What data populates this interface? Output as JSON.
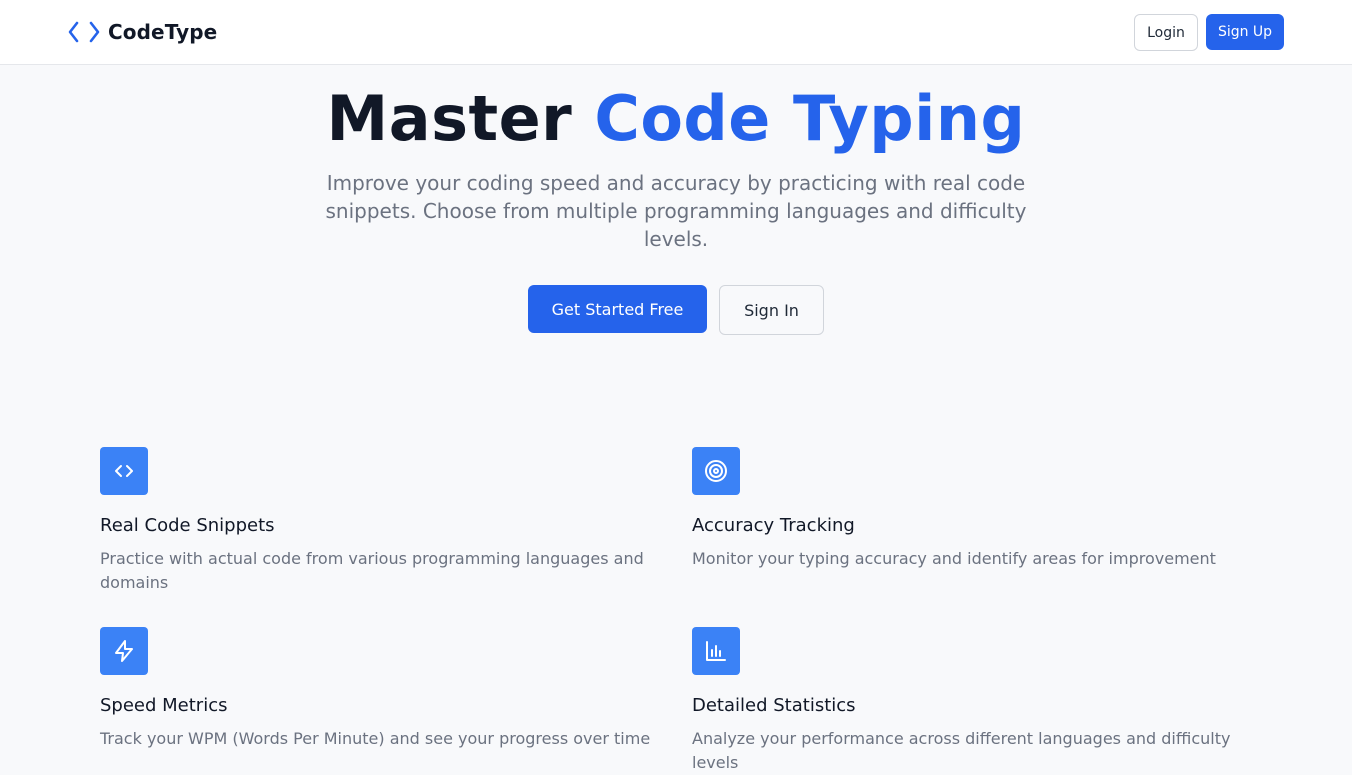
{
  "header": {
    "brand": "CodeType",
    "brand_icon": "code-brackets-icon",
    "login_label": "Login",
    "signup_label": "Sign Up"
  },
  "hero": {
    "title_part1": "Master",
    "title_part2": "Code Typing",
    "subtitle": "Improve your coding speed and accuracy by practicing with real code snippets. Choose from multiple programming languages and difficulty levels.",
    "cta_primary": "Get Started Free",
    "cta_secondary": "Sign In"
  },
  "features": [
    {
      "icon": "code-icon",
      "title": "Real Code Snippets",
      "description": "Practice with actual code from various programming languages and domains"
    },
    {
      "icon": "target-icon",
      "title": "Accuracy Tracking",
      "description": "Monitor your typing accuracy and identify areas for improvement"
    },
    {
      "icon": "lightning-icon",
      "title": "Speed Metrics",
      "description": "Track your WPM (Words Per Minute) and see your progress over time"
    },
    {
      "icon": "bar-chart-icon",
      "title": "Detailed Statistics",
      "description": "Analyze your performance across different languages and difficulty levels"
    }
  ],
  "colors": {
    "accent": "#2563eb",
    "icon_bg": "#3b82f6",
    "background": "#f8f9fb",
    "text_muted": "#6b7280"
  }
}
